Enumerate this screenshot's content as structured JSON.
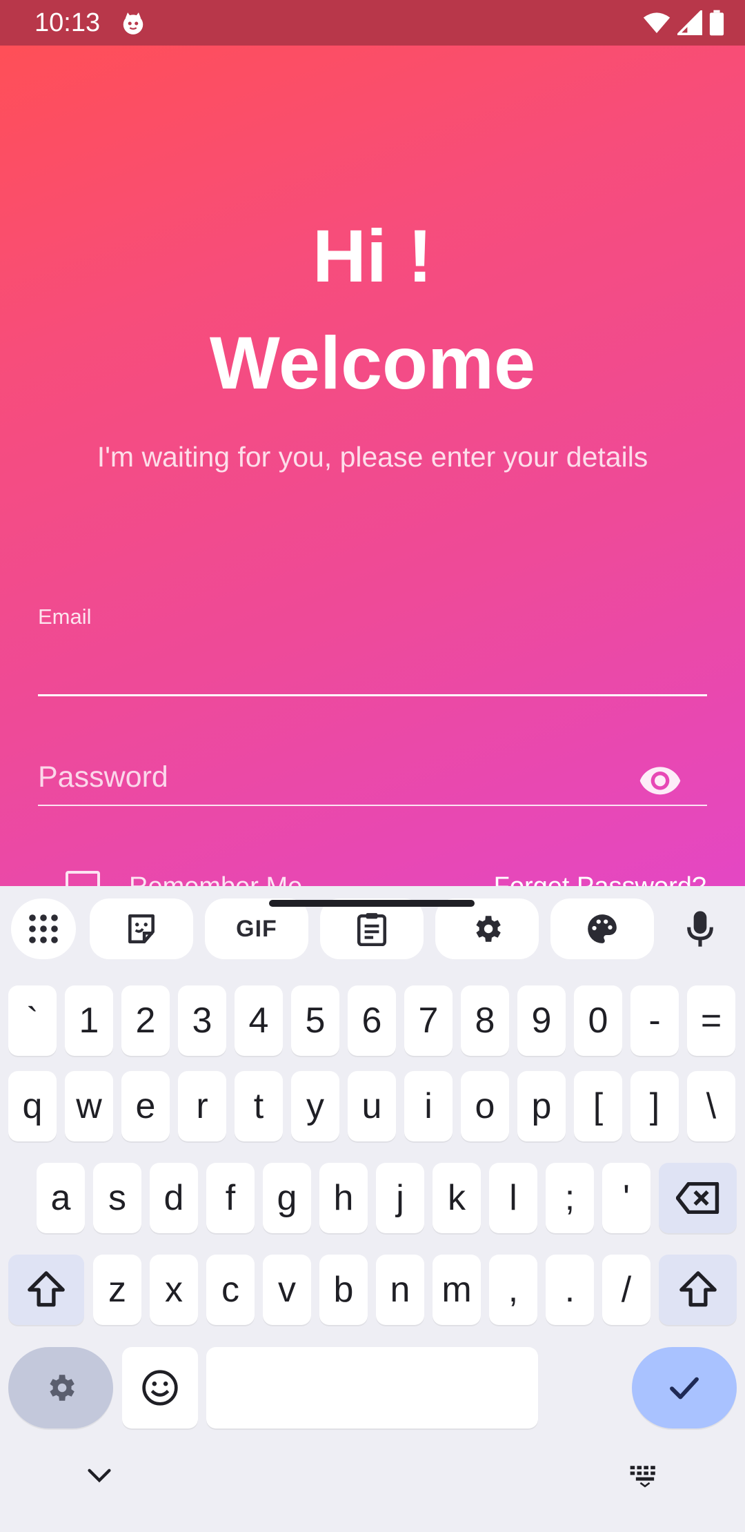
{
  "status_bar": {
    "time": "10:13",
    "app_icon": "cat-face-icon",
    "icons": [
      "wifi-icon",
      "signal-icon",
      "battery-icon"
    ]
  },
  "app": {
    "greeting_line1": "Hi !",
    "greeting_line2": "Welcome",
    "subtitle": "I'm waiting for you, please enter your details",
    "email": {
      "label": "Email",
      "value": ""
    },
    "password": {
      "placeholder": "Password",
      "toggle_icon": "eye-icon"
    },
    "remember_me": {
      "label": "Remember Me",
      "checked": false
    },
    "forgot_password": "Forget Password?",
    "colors": {
      "gradient_start": "#ff4f57",
      "gradient_end": "#e447c4",
      "status_bar": "#b8374a"
    }
  },
  "keyboard": {
    "toolbar": [
      {
        "name": "apps-grid-icon"
      },
      {
        "name": "sticker-icon"
      },
      {
        "name": "gif-button",
        "label": "GIF"
      },
      {
        "name": "clipboard-icon"
      },
      {
        "name": "settings-icon"
      },
      {
        "name": "palette-icon"
      },
      {
        "name": "microphone-icon"
      }
    ],
    "row1": [
      "`",
      "1",
      "2",
      "3",
      "4",
      "5",
      "6",
      "7",
      "8",
      "9",
      "0",
      "-",
      "="
    ],
    "row2": [
      "q",
      "w",
      "e",
      "r",
      "t",
      "y",
      "u",
      "i",
      "o",
      "p",
      "[",
      "]",
      "\\"
    ],
    "row3": [
      "a",
      "s",
      "d",
      "f",
      "g",
      "h",
      "j",
      "k",
      "l",
      ";",
      "'"
    ],
    "row4": [
      "z",
      "x",
      "c",
      "v",
      "b",
      "n",
      "m",
      ",",
      ".",
      "/"
    ],
    "accent_color": "#a9c2ff"
  },
  "nav": {
    "back_icon": "chevron-down-icon",
    "keyboard_icon": "keyboard-icon"
  }
}
